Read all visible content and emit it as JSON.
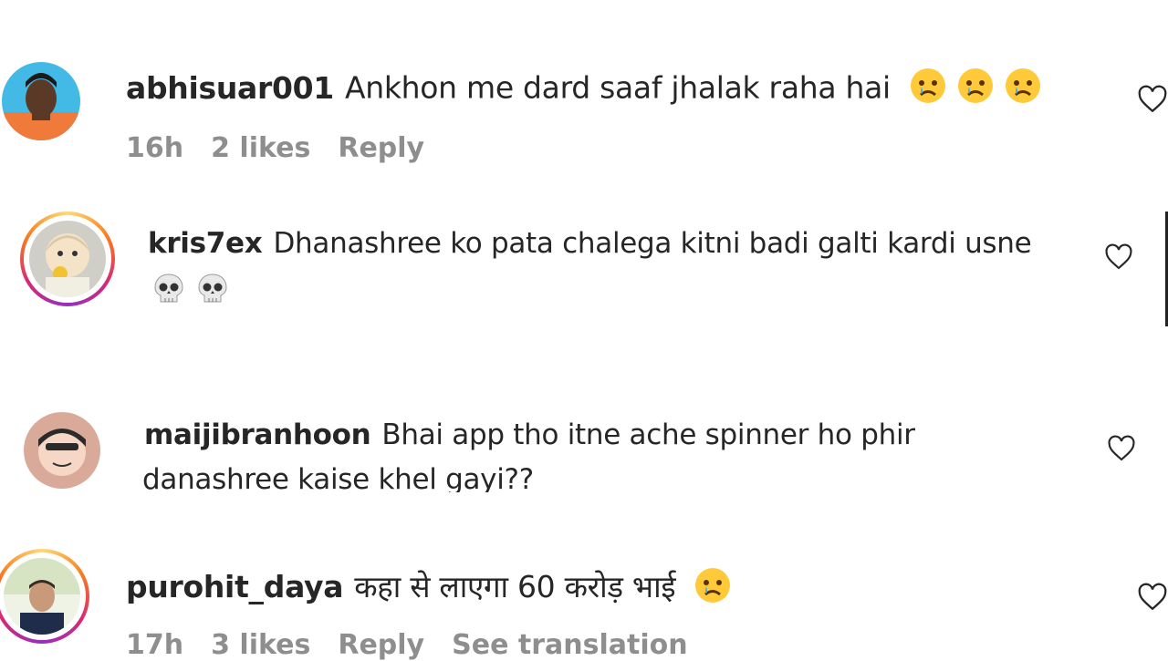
{
  "comments": [
    {
      "username": "abhisuar001",
      "text": "Ankhon me dard saaf jhalak raha hai",
      "emojis": [
        "crying-face",
        "crying-face",
        "crying-face"
      ],
      "time": "16h",
      "likes": "2 likes",
      "reply": "Reply"
    },
    {
      "username": "kris7ex",
      "text": "Dhanashree ko pata chalega kitni badi galti kardi usne",
      "emojis": [
        "skull",
        "skull"
      ]
    },
    {
      "username": "maijibranhoon",
      "text": "Bhai app tho itne ache spinner ho phir",
      "text2": "danashree kaise khel gayi??"
    },
    {
      "username": "purohit_daya",
      "text": "कहा से लाएगा 60 करोड़ भाई",
      "emojis": [
        "crying-face"
      ],
      "time": "17h",
      "likes": "3 likes",
      "reply": "Reply",
      "translate": "See translation"
    }
  ],
  "colors": {
    "username": "#262626",
    "meta": "#8e8e8e",
    "story_ring": [
      "#feda75",
      "#fa7e1e",
      "#d62976",
      "#962fbf"
    ]
  }
}
